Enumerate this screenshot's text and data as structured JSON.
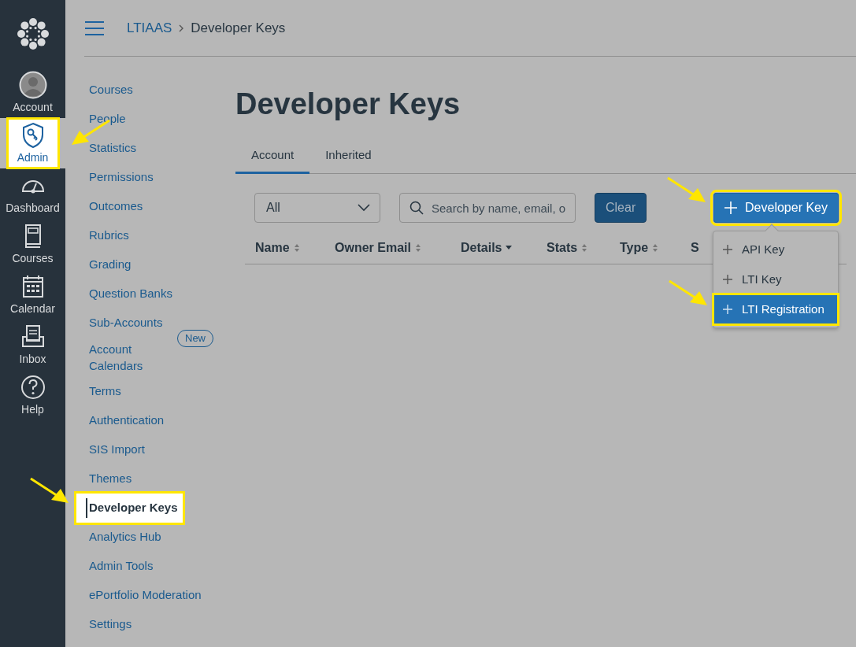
{
  "global_nav": {
    "items": [
      {
        "label": "Account",
        "selected": false,
        "highlighted": false,
        "pointed": false
      },
      {
        "label": "Admin",
        "selected": true,
        "highlighted": true,
        "pointed": true
      },
      {
        "label": "Dashboard",
        "selected": false,
        "highlighted": false,
        "pointed": false
      },
      {
        "label": "Courses",
        "selected": false,
        "highlighted": false,
        "pointed": false
      },
      {
        "label": "Calendar",
        "selected": false,
        "highlighted": false,
        "pointed": false
      },
      {
        "label": "Inbox",
        "selected": false,
        "highlighted": false,
        "pointed": false
      },
      {
        "label": "Help",
        "selected": false,
        "highlighted": false,
        "pointed": false
      }
    ]
  },
  "breadcrumb": [
    {
      "label": "LTIAAS",
      "link": true
    },
    {
      "label": "Developer Keys",
      "link": false
    }
  ],
  "account_nav": [
    {
      "label": "Courses",
      "selected": false,
      "highlighted": false,
      "pointed": false
    },
    {
      "label": "People",
      "selected": false,
      "highlighted": false,
      "pointed": false
    },
    {
      "label": "Statistics",
      "selected": false,
      "highlighted": false,
      "pointed": false
    },
    {
      "label": "Permissions",
      "selected": false,
      "highlighted": false,
      "pointed": false
    },
    {
      "label": "Outcomes",
      "selected": false,
      "highlighted": false,
      "pointed": false
    },
    {
      "label": "Rubrics",
      "selected": false,
      "highlighted": false,
      "pointed": false
    },
    {
      "label": "Grading",
      "selected": false,
      "highlighted": false,
      "pointed": false
    },
    {
      "label": "Question Banks",
      "selected": false,
      "highlighted": false,
      "pointed": false
    },
    {
      "label": "Sub-Accounts",
      "selected": false,
      "highlighted": false,
      "pointed": false
    },
    {
      "label": "Account Calendars",
      "badge": "New",
      "selected": false,
      "highlighted": false,
      "pointed": false
    },
    {
      "label": "Terms",
      "selected": false,
      "highlighted": false,
      "pointed": false
    },
    {
      "label": "Authentication",
      "selected": false,
      "highlighted": false,
      "pointed": false
    },
    {
      "label": "SIS Import",
      "selected": false,
      "highlighted": false,
      "pointed": false
    },
    {
      "label": "Themes",
      "selected": false,
      "highlighted": false,
      "pointed": false
    },
    {
      "label": "Developer Keys",
      "selected": true,
      "highlighted": true,
      "pointed": true
    },
    {
      "label": "Analytics Hub",
      "selected": false,
      "highlighted": false,
      "pointed": false
    },
    {
      "label": "Admin Tools",
      "selected": false,
      "highlighted": false,
      "pointed": false
    },
    {
      "label": "ePortfolio Moderation",
      "selected": false,
      "highlighted": false,
      "pointed": false
    },
    {
      "label": "Settings",
      "selected": false,
      "highlighted": false,
      "pointed": false
    }
  ],
  "page_title": "Developer Keys",
  "tabs": [
    {
      "label": "Account",
      "selected": true
    },
    {
      "label": "Inherited",
      "selected": false
    }
  ],
  "filter": {
    "select_value": "All",
    "search_placeholder": "Search by name, email, o",
    "clear_button": "Clear"
  },
  "add_button": {
    "label": "Developer Key",
    "highlighted": true,
    "pointed": true,
    "expanded": true
  },
  "add_menu": [
    {
      "label": "API Key",
      "selected": false,
      "highlighted": false,
      "pointed": false
    },
    {
      "label": "LTI Key",
      "selected": false,
      "highlighted": false,
      "pointed": false
    },
    {
      "label": "LTI Registration",
      "selected": true,
      "highlighted": true,
      "pointed": true
    }
  ],
  "table": {
    "columns": [
      {
        "label": "Name",
        "sortable": true,
        "sorted": false
      },
      {
        "label": "Owner Email",
        "sortable": true,
        "sorted": false
      },
      {
        "label": "Details",
        "sortable": true,
        "sorted": true
      },
      {
        "label": "Stats",
        "sortable": true,
        "sorted": false
      },
      {
        "label": "Type",
        "sortable": true,
        "sorted": false
      },
      {
        "label": "S"
      }
    ]
  }
}
